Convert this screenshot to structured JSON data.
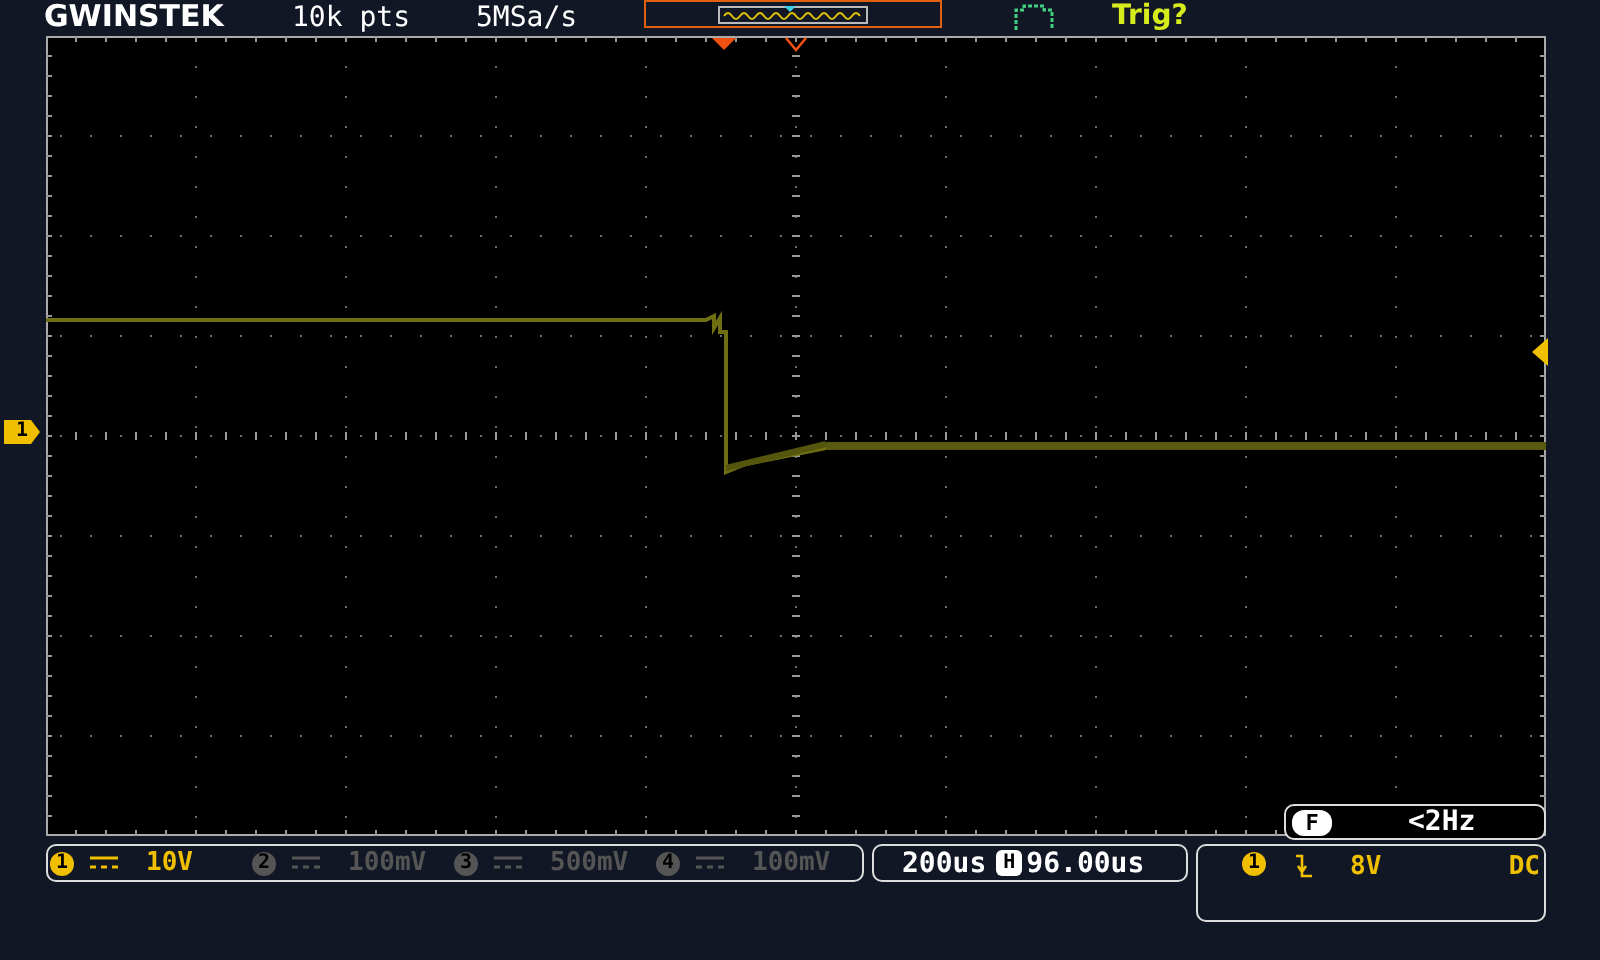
{
  "header": {
    "brand": "GWINSTEK",
    "record_length": "10k pts",
    "sample_rate": "5MSa/s",
    "trigger_status": "Trig?"
  },
  "channel_marker": "1",
  "frequency": {
    "marker": "F",
    "value": "<2Hz"
  },
  "channels": [
    {
      "number": "1",
      "on": true,
      "scale": "10V"
    },
    {
      "number": "2",
      "on": false,
      "scale": "100mV"
    },
    {
      "number": "3",
      "on": false,
      "scale": "500mV"
    },
    {
      "number": "4",
      "on": false,
      "scale": "100mV"
    }
  ],
  "timebase": {
    "scale": "200us",
    "marker": "H",
    "position": "96.00us"
  },
  "trigger": {
    "source": "1",
    "level": "8V",
    "coupling": "DC"
  }
}
